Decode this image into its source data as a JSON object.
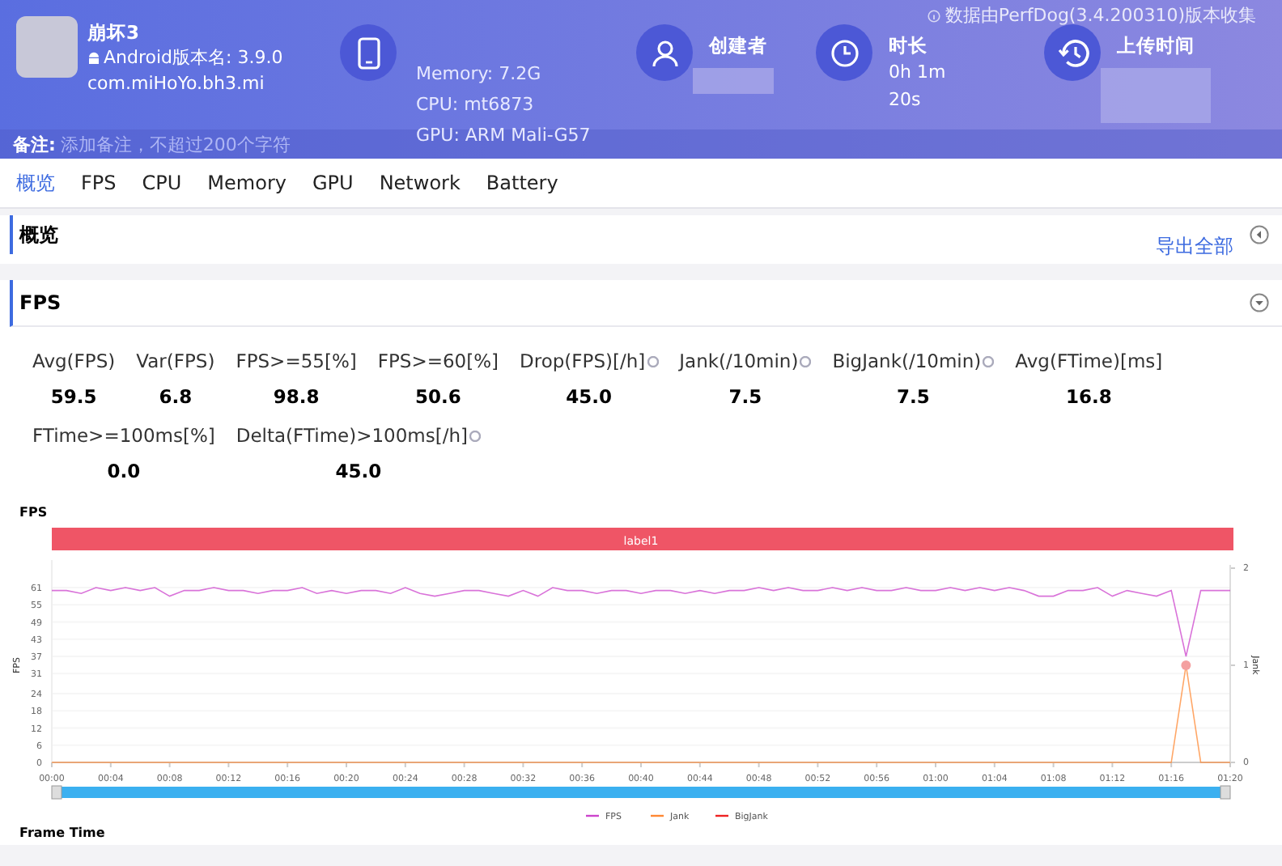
{
  "header": {
    "app_name": "崩坏3",
    "android_version": "Android版本名: 3.9.0",
    "package": "com.miHoYo.bh3.mi",
    "device": [
      "Memory: 7.2G",
      "CPU: mt6873",
      "GPU: ARM Mali-G57"
    ],
    "source_note": "数据由PerfDog(3.4.200310)版本收集",
    "creator_label": "创建者",
    "duration_label": "时长",
    "duration_value": [
      "0h 1m",
      "20s"
    ],
    "upload_label": "上传时间",
    "remark_label": "备注:",
    "remark_placeholder": "添加备注，不超过200个字符"
  },
  "tabs": [
    {
      "label": "概览",
      "selected": true
    },
    {
      "label": "FPS",
      "selected": false
    },
    {
      "label": "CPU",
      "selected": false
    },
    {
      "label": "Memory",
      "selected": false
    },
    {
      "label": "GPU",
      "selected": false
    },
    {
      "label": "Network",
      "selected": false
    },
    {
      "label": "Battery",
      "selected": false
    }
  ],
  "overview": {
    "title": "概览",
    "export_link": "导出全部"
  },
  "fps_section": {
    "title": "FPS",
    "stats": [
      {
        "label": "Avg(FPS)",
        "value": "59.5",
        "hint": false
      },
      {
        "label": "Var(FPS)",
        "value": "6.8",
        "hint": false
      },
      {
        "label": "FPS>=55[%]",
        "value": "98.8",
        "hint": false
      },
      {
        "label": "FPS>=60[%]",
        "value": "50.6",
        "hint": false
      },
      {
        "label": "Drop(FPS)[/h]",
        "value": "45.0",
        "hint": true
      },
      {
        "label": "Jank(/10min)",
        "value": "7.5",
        "hint": true
      },
      {
        "label": "BigJank(/10min)",
        "value": "7.5",
        "hint": true
      },
      {
        "label": "Avg(FTime)[ms]",
        "value": "16.8",
        "hint": false
      },
      {
        "label": "FTime>=100ms[%]",
        "value": "0.0",
        "hint": false
      },
      {
        "label": "Delta(FTime)>100ms[/h]",
        "value": "45.0",
        "hint": true
      }
    ],
    "chart_title": "FPS",
    "label_bar": "label1",
    "chart_data": {
      "type": "line",
      "ylabel": "FPS",
      "y2label": "Jank",
      "ylim": [
        0,
        67.8
      ],
      "y2lim": [
        0,
        2
      ],
      "x": [
        0,
        1,
        2,
        3,
        4,
        5,
        6,
        7,
        8,
        9,
        10,
        11,
        12,
        13,
        14,
        15,
        16,
        17,
        18,
        19,
        20,
        21,
        22,
        23,
        24,
        25,
        26,
        27,
        28,
        29,
        30,
        31,
        32,
        33,
        34,
        35,
        36,
        37,
        38,
        39,
        40,
        41,
        42,
        43,
        44,
        45,
        46,
        47,
        48,
        49,
        50,
        51,
        52,
        53,
        54,
        55,
        56,
        57,
        58,
        59,
        60,
        61,
        62,
        63,
        64,
        65,
        66,
        67,
        68,
        69,
        70,
        71,
        72,
        73,
        74,
        75,
        76,
        77,
        78,
        79,
        80
      ],
      "xlim": [
        0,
        80
      ],
      "xticks": [
        {
          "value": 0,
          "label": "00:00"
        },
        {
          "value": 4,
          "label": "00:04"
        },
        {
          "value": 8,
          "label": "00:08"
        },
        {
          "value": 12,
          "label": "00:12"
        },
        {
          "value": 16,
          "label": "00:16"
        },
        {
          "value": 20,
          "label": "00:20"
        },
        {
          "value": 24,
          "label": "00:24"
        },
        {
          "value": 28,
          "label": "00:28"
        },
        {
          "value": 32,
          "label": "00:32"
        },
        {
          "value": 36,
          "label": "00:36"
        },
        {
          "value": 40,
          "label": "00:40"
        },
        {
          "value": 44,
          "label": "00:44"
        },
        {
          "value": 48,
          "label": "00:48"
        },
        {
          "value": 52,
          "label": "00:52"
        },
        {
          "value": 56,
          "label": "00:56"
        },
        {
          "value": 60,
          "label": "01:00"
        },
        {
          "value": 64,
          "label": "01:04"
        },
        {
          "value": 68,
          "label": "01:08"
        },
        {
          "value": 72,
          "label": "01:12"
        },
        {
          "value": 76,
          "label": "01:16"
        },
        {
          "value": 80,
          "label": "01:20"
        }
      ],
      "yticks": [
        0,
        6,
        12,
        18,
        24,
        31,
        37,
        43,
        49,
        55,
        61
      ],
      "y2ticks": [
        0,
        1,
        2
      ],
      "series": [
        {
          "name": "FPS",
          "color": "#cc44cc",
          "values": [
            60,
            60,
            59,
            61,
            60,
            61,
            60,
            61,
            58,
            60,
            60,
            61,
            60,
            60,
            59,
            60,
            60,
            61,
            59,
            60,
            59,
            60,
            60,
            59,
            61,
            59,
            58,
            59,
            60,
            60,
            59,
            58,
            60,
            58,
            61,
            60,
            60,
            59,
            60,
            60,
            59,
            60,
            60,
            59,
            60,
            59,
            60,
            60,
            61,
            60,
            61,
            60,
            60,
            61,
            60,
            61,
            60,
            60,
            61,
            60,
            60,
            61,
            60,
            61,
            60,
            61,
            60,
            58,
            58,
            60,
            60,
            61,
            58,
            60,
            59,
            58,
            60,
            37,
            60,
            60,
            60
          ]
        },
        {
          "name": "Jank",
          "color": "#ff8833",
          "axis": "y2",
          "values": [
            0,
            0,
            0,
            0,
            0,
            0,
            0,
            0,
            0,
            0,
            0,
            0,
            0,
            0,
            0,
            0,
            0,
            0,
            0,
            0,
            0,
            0,
            0,
            0,
            0,
            0,
            0,
            0,
            0,
            0,
            0,
            0,
            0,
            0,
            0,
            0,
            0,
            0,
            0,
            0,
            0,
            0,
            0,
            0,
            0,
            0,
            0,
            0,
            0,
            0,
            0,
            0,
            0,
            0,
            0,
            0,
            0,
            0,
            0,
            0,
            0,
            0,
            0,
            0,
            0,
            0,
            0,
            0,
            0,
            0,
            0,
            0,
            0,
            0,
            0,
            0,
            0,
            1,
            0,
            0,
            0
          ]
        },
        {
          "name": "BigJank",
          "color": "#ee2222",
          "axis": "y2",
          "values": [
            null,
            null,
            null,
            null,
            null,
            null,
            null,
            null,
            null,
            null,
            null,
            null,
            null,
            null,
            null,
            null,
            null,
            null,
            null,
            null,
            null,
            null,
            null,
            null,
            null,
            null,
            null,
            null,
            null,
            null,
            null,
            null,
            null,
            null,
            null,
            null,
            null,
            null,
            null,
            null,
            null,
            null,
            null,
            null,
            null,
            null,
            null,
            null,
            null,
            null,
            null,
            null,
            null,
            null,
            null,
            null,
            null,
            null,
            null,
            null,
            null,
            null,
            null,
            null,
            null,
            null,
            null,
            null,
            null,
            null,
            null,
            null,
            null,
            null,
            null,
            null,
            null,
            null,
            null,
            null,
            null
          ]
        }
      ],
      "grid": true,
      "legend": "bottom"
    },
    "next_title": "Frame Time"
  }
}
